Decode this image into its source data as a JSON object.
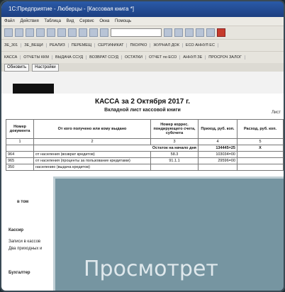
{
  "window": {
    "title": "1С:Предприятие - Люберцы - [Касcовая книга *]"
  },
  "menu": [
    "Файл",
    "Действия",
    "Таблица",
    "Вид",
    "Сервис",
    "Окна",
    "Помощь"
  ],
  "toolbar2": [
    "ЗЕ_301",
    "ЗЕ_ВЕЩИ",
    "РЕАЛИЗ",
    "ПЕРЕМЕЩ",
    "СЕРТИФИКАТ",
    "ПКО/РКО",
    "ЖУРНАЛ ДОК",
    "ЕСО АННУЛ ЕС"
  ],
  "toolbar3": [
    "КАССА",
    "ОТЧЕТЫ ККМ",
    "ВЫДАЧА ССУД",
    "ВОЗВРАТ ССУД",
    "ОСТАТКИ",
    "ОТЧЕТ по ЕСО",
    "АННУЛ ЗЕ",
    "ПРОСРОЧ ЗАЛОГ"
  ],
  "subtabs": [
    "Обновить",
    "Настройки"
  ],
  "document": {
    "title": "КАССА за 2 Октября 2017 г.",
    "subtitle": "Вкладной лист кассовой книги",
    "list_label": "Лист",
    "columns": [
      "Номер документа",
      "От кого получено или кому выдано",
      "Номер коррес. пондирующего счета, субсчета",
      "Приход, руб. коп.",
      "Расход, руб. коп."
    ],
    "col_numbers": [
      "1",
      "2",
      "3",
      "4",
      "5"
    ],
    "balance_label": "Остаток на начало дня",
    "balance_value": "134445=25",
    "balance_x": "X",
    "rows": [
      {
        "num": "964",
        "desc": "от населения (возврат кредитов)",
        "acc": "58.3",
        "in": "103034=00",
        "out": ""
      },
      {
        "num": "965",
        "desc": "от населения (проценты за пользование кредитами)",
        "acc": "91.1.1",
        "in": "29596=00",
        "out": ""
      },
      {
        "num": "350",
        "desc": "населению (выдача кредитов)",
        "acc": "",
        "in": "",
        "out": ""
      }
    ],
    "in_tom_label": "в том",
    "cashier_label": "Кассир",
    "records_label": "Записи в кассов",
    "two_records_label": "Два приходных и",
    "accountant_label": "Бухгалтер"
  },
  "overlay": {
    "text": "Просмотрет"
  }
}
